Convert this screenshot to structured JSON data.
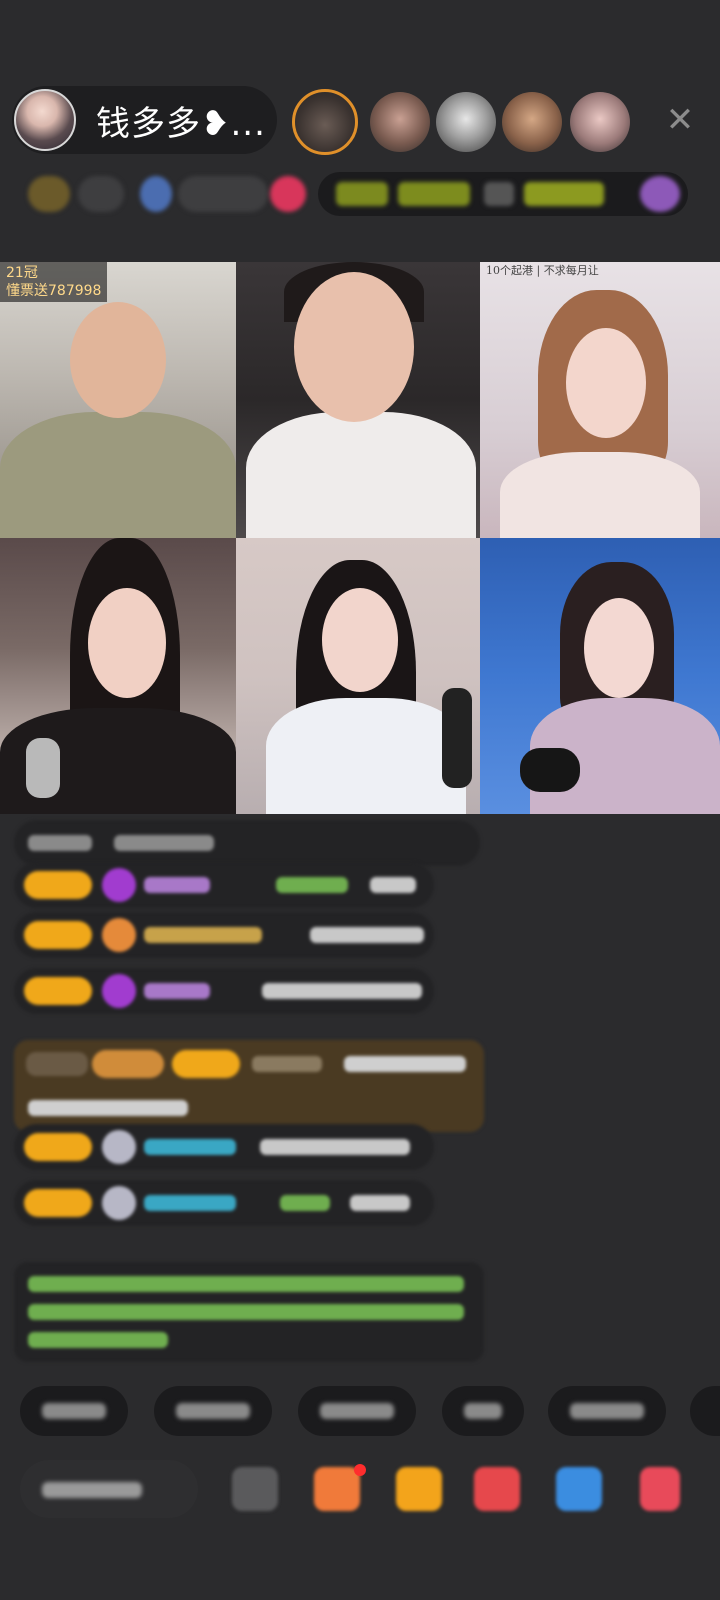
{
  "host": {
    "name": "钱多多❥..."
  },
  "video_tiles": [
    {
      "badge_line1": "21冠",
      "badge_line2": "懂票送787998"
    },
    {},
    {
      "note": "10个起港 | 不求每月让"
    },
    {},
    {},
    {}
  ],
  "colors": {
    "background": "#2b2b2d",
    "level_badge": "#f0a81a",
    "notice_bg": "#4a3a22",
    "system_text": "#6fae4f"
  },
  "icons": {
    "close": "close-icon",
    "emoji": "emoji-icon",
    "gift": "gift-icon",
    "share": "share-icon"
  }
}
